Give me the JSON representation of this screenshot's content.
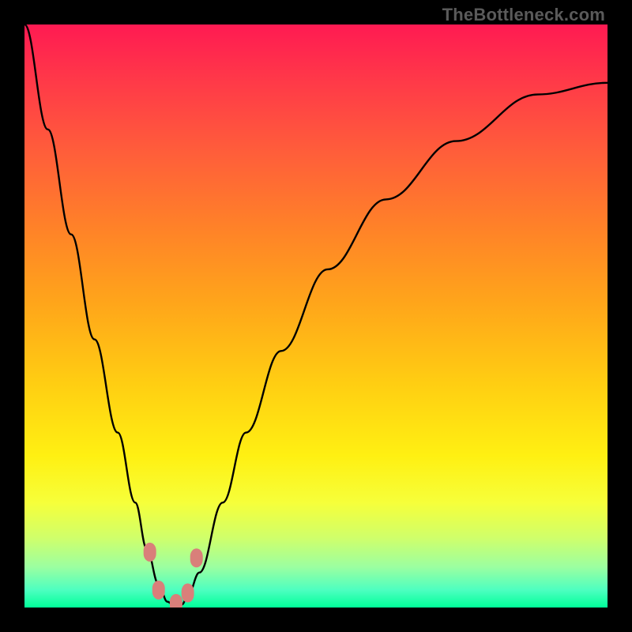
{
  "watermark": "TheBottleneck.com",
  "chart_data": {
    "type": "line",
    "title": "",
    "xlabel": "",
    "ylabel": "",
    "xlim": [
      0,
      100
    ],
    "ylim": [
      0,
      100
    ],
    "grid": false,
    "series": [
      {
        "name": "curve",
        "x": [
          0,
          4,
          8,
          12,
          16,
          19,
          21,
          23,
          24.5,
          26,
          27,
          28,
          30,
          34,
          38,
          44,
          52,
          62,
          74,
          88,
          100
        ],
        "y": [
          100,
          82,
          64,
          46,
          30,
          18,
          10,
          4,
          1,
          0,
          0.5,
          2,
          6,
          18,
          30,
          44,
          58,
          70,
          80,
          88,
          90
        ]
      }
    ],
    "markers": [
      {
        "x": 21.5,
        "y": 9.5
      },
      {
        "x": 23.0,
        "y": 3.0
      },
      {
        "x": 26.0,
        "y": 0.7
      },
      {
        "x": 28.0,
        "y": 2.5
      },
      {
        "x": 29.5,
        "y": 8.5
      }
    ],
    "color_gradient": {
      "top": "#ff1a52",
      "mid": "#fff012",
      "bottom": "#00ff99"
    },
    "curve_color": "#000000",
    "marker_color": "#d97f7a"
  }
}
